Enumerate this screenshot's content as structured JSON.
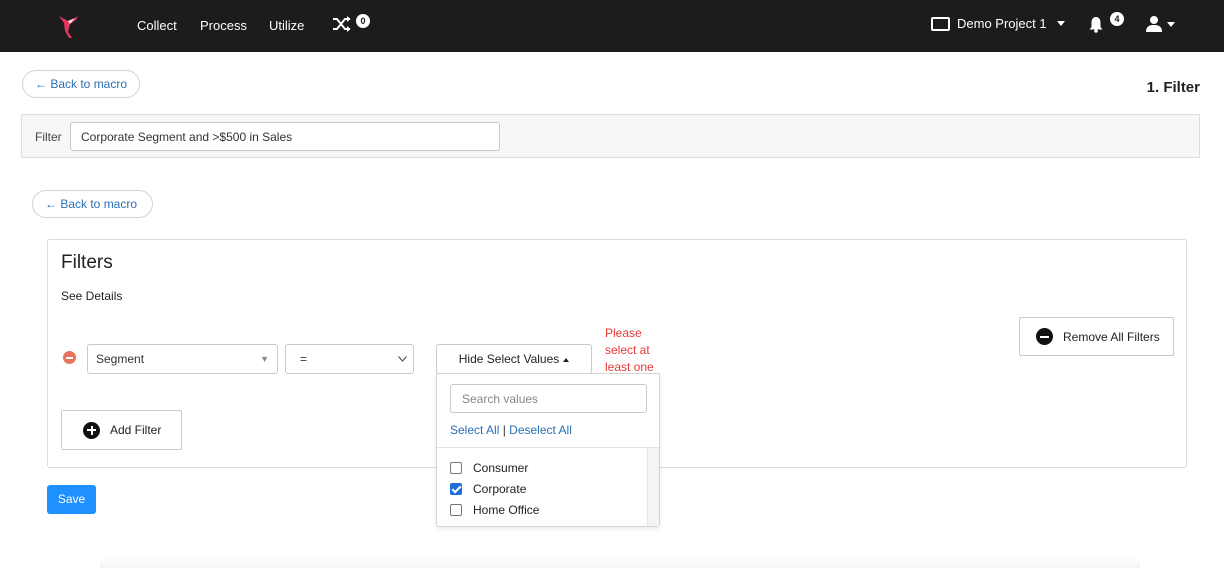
{
  "nav": {
    "links": [
      "Collect",
      "Process",
      "Utilize"
    ],
    "shuffle_badge": "0",
    "project_label": "Demo Project 1",
    "notification_count": "4",
    "icons": [
      "hummingbird-logo-icon",
      "shuffle-icon",
      "folder-icon",
      "bell-icon",
      "user-icon",
      "chevron-down-icon"
    ]
  },
  "header": {
    "back_label": "← Back to macro",
    "step_title": "1. Filter"
  },
  "filter_bar": {
    "label": "Filter",
    "value": "Corporate Segment and >$500 in Sales"
  },
  "filters": {
    "back_label": "← Back to macro",
    "title": "Filters",
    "see_details": "See Details",
    "row": {
      "field": "Segment",
      "operator": "=",
      "values_toggle": "Hide Select Values",
      "error": "Please select at least one"
    },
    "remove_all_label": "Remove All Filters",
    "add_filter_label": "Add Filter",
    "save_label": "Save"
  },
  "dropdown": {
    "search_placeholder": "Search values",
    "select_all": "Select All",
    "separator": "|",
    "deselect_all": "Deselect All",
    "options": [
      {
        "label": "Consumer",
        "checked": false
      },
      {
        "label": "Corporate",
        "checked": true
      },
      {
        "label": "Home Office",
        "checked": false
      }
    ]
  },
  "colors": {
    "nav_bg": "#1c1c1c",
    "link": "#2a6fb4",
    "error": "#e53935",
    "primary": "#1e90ff",
    "remove_icon": "#e8745f",
    "checkbox": "#1e6fd9"
  }
}
